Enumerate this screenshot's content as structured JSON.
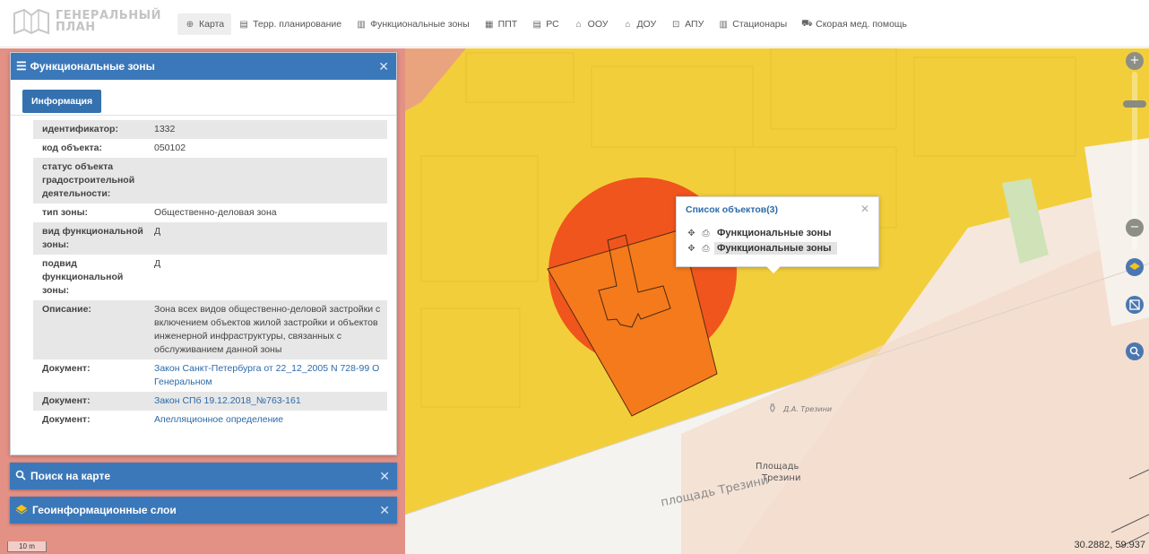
{
  "header": {
    "logo_line1": "ГЕНЕРАЛЬНЫЙ",
    "logo_line2": "ПЛАН",
    "nav": [
      {
        "label": "Карта",
        "icon": "globe-icon",
        "glyph": "⊕",
        "active": true
      },
      {
        "label": "Терр. планирование",
        "icon": "document-icon",
        "glyph": "▤"
      },
      {
        "label": "Функциональные зоны",
        "icon": "grid-icon",
        "glyph": "▥"
      },
      {
        "label": "ППТ",
        "icon": "table-icon",
        "glyph": "▦"
      },
      {
        "label": "РС",
        "icon": "list-icon",
        "glyph": "▤"
      },
      {
        "label": "ООУ",
        "icon": "institution-icon",
        "glyph": "⌂"
      },
      {
        "label": "ДОУ",
        "icon": "kindergarten-icon",
        "glyph": "⌂"
      },
      {
        "label": "АПУ",
        "icon": "clinic-icon",
        "glyph": "⊡"
      },
      {
        "label": "Стационары",
        "icon": "hospital-icon",
        "glyph": "▥"
      },
      {
        "label": "Скорая мед. помощь",
        "icon": "ambulance-icon",
        "glyph": "⛟"
      }
    ]
  },
  "panel": {
    "title": "Функциональные зоны",
    "tab_label": "Информация",
    "rows": [
      {
        "key": "идентификатор:",
        "value": "1332",
        "link": false
      },
      {
        "key": "код объекта:",
        "value": "050102",
        "link": false
      },
      {
        "key": "статус объекта градостроительной деятельности:",
        "value": "",
        "link": false
      },
      {
        "key": "тип зоны:",
        "value": "Общественно-деловая зона",
        "link": false
      },
      {
        "key": "вид функциональной зоны:",
        "value": "Д",
        "link": false
      },
      {
        "key": "подвид функциональной зоны:",
        "value": "Д",
        "link": false
      },
      {
        "key": "Описание:",
        "value": "Зона всех видов общественно-деловой застройки с включением объектов жилой застройки и объектов инженерной инфраструктуры, связанных с обслуживанием данной зоны",
        "link": false
      },
      {
        "key": "Документ:",
        "value": "Закон Санкт-Петербурга от 22_12_2005 N 728-99 О Генеральном",
        "link": true
      },
      {
        "key": "Документ:",
        "value": "Закон СПб 19.12.2018_№763-161",
        "link": true
      },
      {
        "key": "Документ:",
        "value": "Апелляционное определение",
        "link": true
      }
    ]
  },
  "search_panel": {
    "title": "Поиск на карте"
  },
  "layers_panel": {
    "title": "Геоинформационные слои"
  },
  "popup": {
    "title": "Список объектов(3)",
    "items": [
      {
        "label": "Функциональные зоны",
        "highlighted": false
      },
      {
        "label": "Функциональные зоны",
        "highlighted": true
      }
    ]
  },
  "map": {
    "coordinates": "30.2882, 59.937",
    "scale_label": "10 m",
    "labels": {
      "monument": "Д.А. Трезини",
      "square_line1": "Площадь",
      "square_line2": "Трезини",
      "street": "площадь Трезини"
    },
    "colors": {
      "yellow_zone": "#f2cf3a",
      "orange_selection": "#f47a1c",
      "red_circle": "#f04b1c",
      "red_zone": "#e07f78",
      "header_blue": "#3b78ba"
    }
  }
}
